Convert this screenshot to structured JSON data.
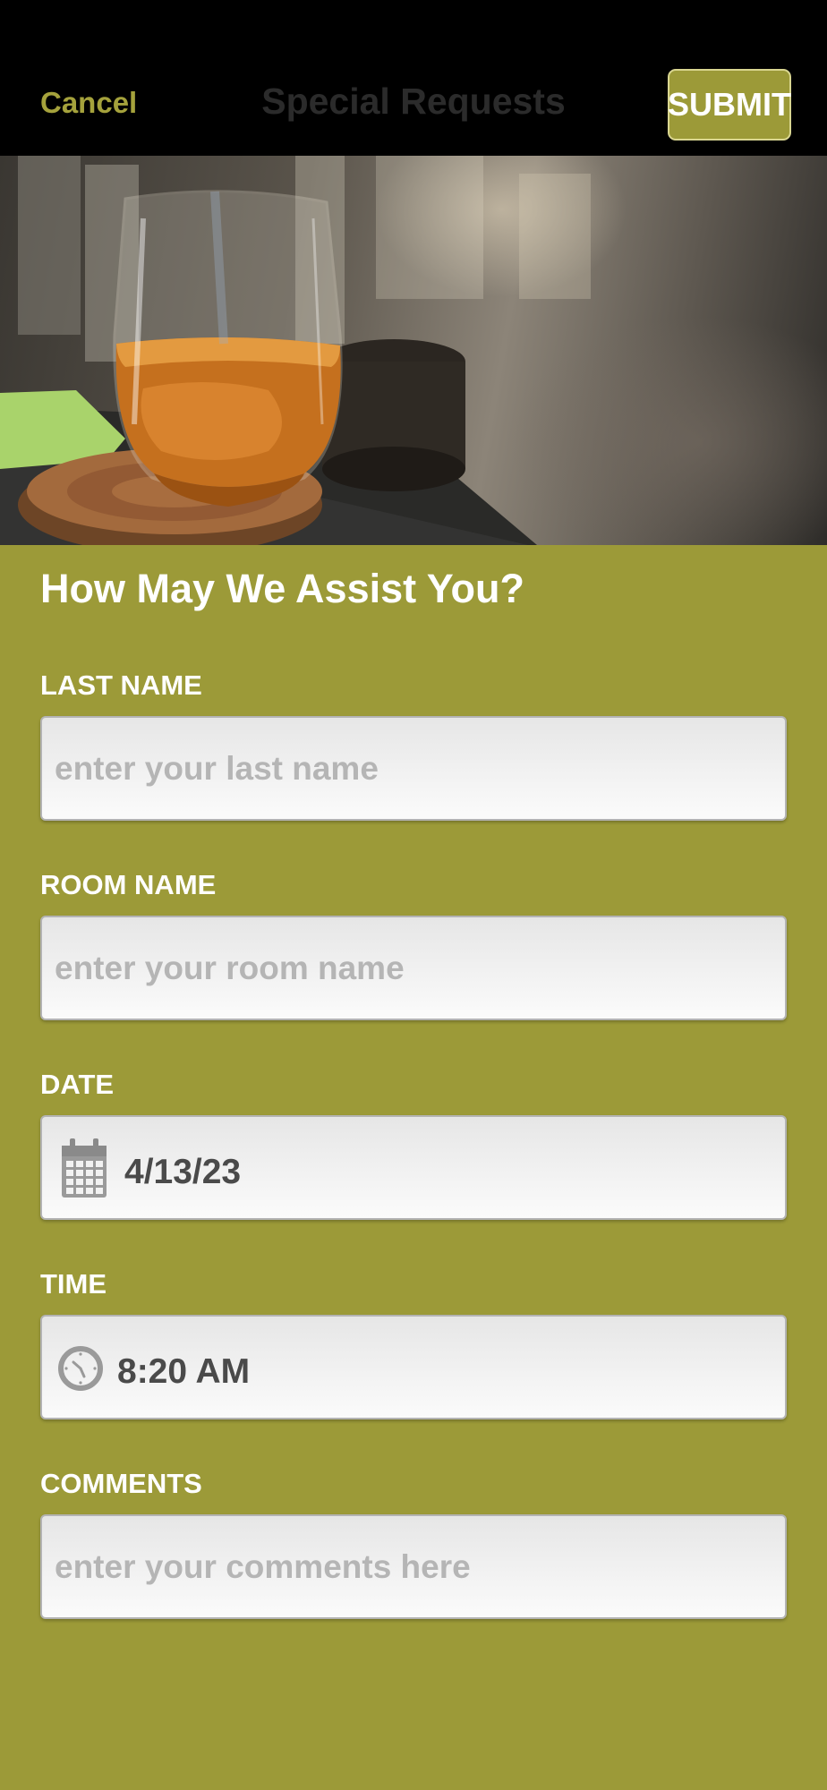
{
  "header": {
    "cancel_label": "Cancel",
    "title": "Special Requests",
    "submit_label": "SUBMIT"
  },
  "form": {
    "heading": "How May We Assist You?",
    "last_name": {
      "label": "LAST NAME",
      "placeholder": "enter your last name"
    },
    "room_name": {
      "label": "ROOM NAME",
      "placeholder": "enter your room name"
    },
    "date": {
      "label": "DATE",
      "value": "4/13/23",
      "icon": "calendar-icon"
    },
    "time": {
      "label": "TIME",
      "value": "8:20 AM",
      "icon": "clock-icon"
    },
    "comments": {
      "label": "COMMENTS",
      "placeholder": "enter your comments here"
    }
  },
  "colors": {
    "accent": "#9c9a38",
    "header_background": "#000000",
    "cancel_text": "#a5a23c"
  },
  "hero": {
    "subject": "glass of whiskey on a wooden coaster at a bar"
  }
}
